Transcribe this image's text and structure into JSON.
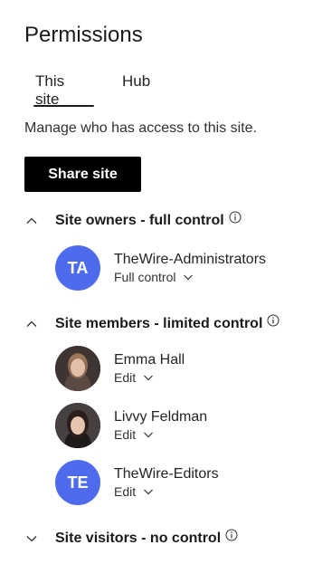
{
  "panel": {
    "title": "Permissions",
    "description": "Manage who has access to this site.",
    "share_button_label": "Share site"
  },
  "tabs": [
    {
      "label": "This site",
      "selected": true
    },
    {
      "label": "Hub",
      "selected": false
    }
  ],
  "colors": {
    "accent_avatar": "#4f6bed",
    "button_bg": "#000000"
  },
  "sections": [
    {
      "label": "Site owners - full control",
      "expanded": true,
      "members": [
        {
          "name": "TheWire-Administrators",
          "initials": "TA",
          "permission": "Full control",
          "avatar": "initials"
        }
      ]
    },
    {
      "label": "Site members - limited control",
      "expanded": true,
      "members": [
        {
          "name": "Emma Hall",
          "initials": "",
          "permission": "Edit",
          "avatar": "photo"
        },
        {
          "name": "Livvy Feldman",
          "initials": "",
          "permission": "Edit",
          "avatar": "photo"
        },
        {
          "name": "TheWire-Editors",
          "initials": "TE",
          "permission": "Edit",
          "avatar": "initials"
        }
      ]
    },
    {
      "label": "Site visitors - no control",
      "expanded": false,
      "members": []
    }
  ]
}
